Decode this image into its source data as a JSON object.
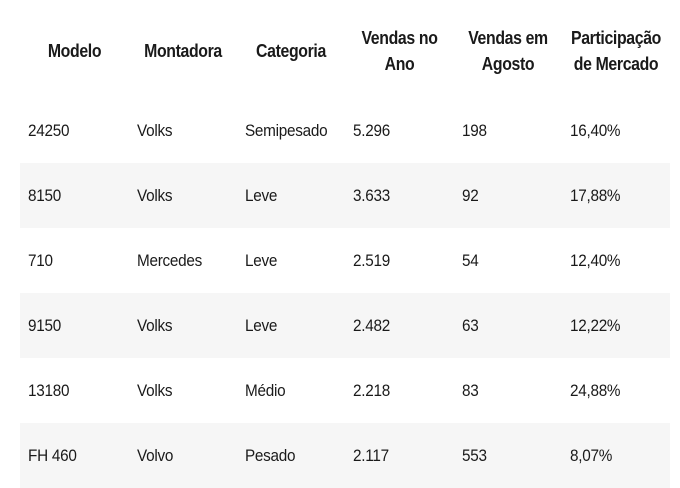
{
  "table": {
    "headers": [
      [
        "Modelo"
      ],
      [
        "Montadora"
      ],
      [
        "Categoria"
      ],
      [
        "Vendas no",
        "Ano"
      ],
      [
        "Vendas em",
        "Agosto"
      ],
      [
        "Participação",
        "de Mercado"
      ]
    ],
    "rows": [
      [
        "24250",
        "Volks",
        "Semipesado",
        "5.296",
        "198",
        "16,40%"
      ],
      [
        "8150",
        "Volks",
        "Leve",
        "3.633",
        "92",
        "17,88%"
      ],
      [
        "710",
        "Mercedes",
        "Leve",
        "2.519",
        "54",
        "12,40%"
      ],
      [
        "9150",
        "Volks",
        "Leve",
        "2.482",
        "63",
        "12,22%"
      ],
      [
        "13180",
        "Volks",
        "Médio",
        "2.218",
        "83",
        "24,88%"
      ],
      [
        "FH 460",
        "Volvo",
        "Pesado",
        "2.117",
        "553",
        "8,07%"
      ]
    ]
  },
  "colors": {
    "zebra": "#f6f6f6",
    "text": "#1a1a1a"
  }
}
